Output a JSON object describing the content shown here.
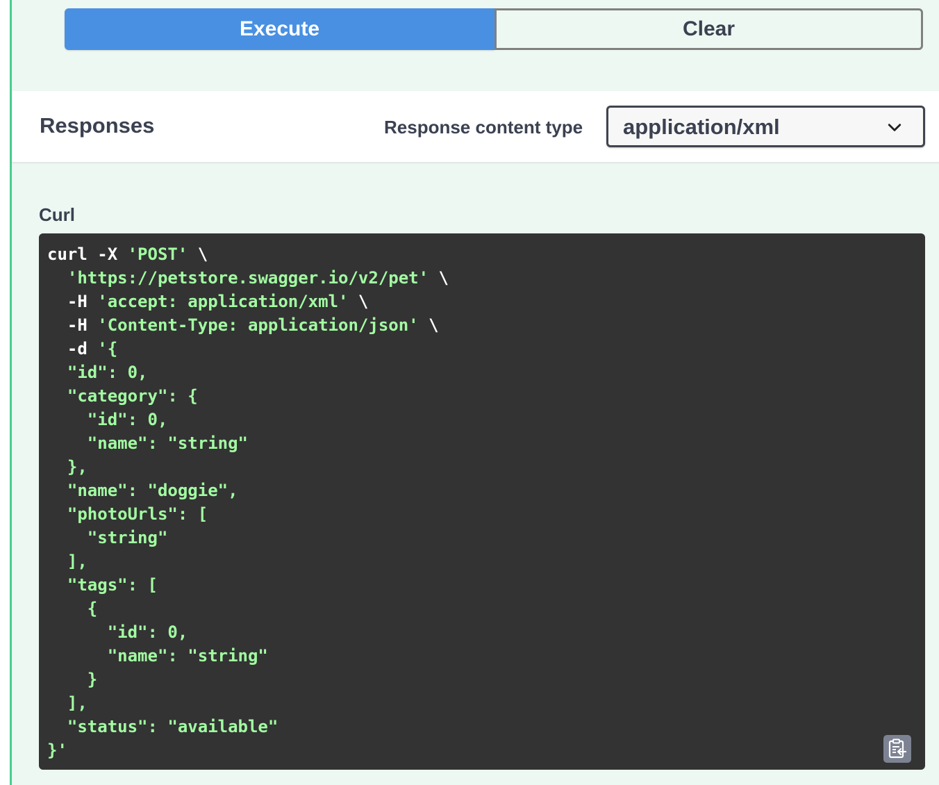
{
  "actions": {
    "execute_label": "Execute",
    "clear_label": "Clear"
  },
  "responses": {
    "title": "Responses",
    "content_type_label": "Response content type",
    "content_type_value": "application/xml"
  },
  "curl": {
    "label": "Curl",
    "lines": [
      [
        [
          "plain",
          "curl -X "
        ],
        [
          "str",
          "'POST'"
        ],
        [
          "plain",
          " \\"
        ]
      ],
      [
        [
          "plain",
          "  "
        ],
        [
          "str",
          "'https://petstore.swagger.io/v2/pet'"
        ],
        [
          "plain",
          " \\"
        ]
      ],
      [
        [
          "plain",
          "  -H "
        ],
        [
          "str",
          "'accept: application/xml'"
        ],
        [
          "plain",
          " \\"
        ]
      ],
      [
        [
          "plain",
          "  -H "
        ],
        [
          "str",
          "'Content-Type: application/json'"
        ],
        [
          "plain",
          " \\"
        ]
      ],
      [
        [
          "plain",
          "  -d "
        ],
        [
          "str",
          "'{"
        ]
      ],
      [
        [
          "str",
          "  \"id\": 0,"
        ]
      ],
      [
        [
          "str",
          "  \"category\": {"
        ]
      ],
      [
        [
          "str",
          "    \"id\": 0,"
        ]
      ],
      [
        [
          "str",
          "    \"name\": \"string\""
        ]
      ],
      [
        [
          "str",
          "  },"
        ]
      ],
      [
        [
          "str",
          "  \"name\": \"doggie\","
        ]
      ],
      [
        [
          "str",
          "  \"photoUrls\": ["
        ]
      ],
      [
        [
          "str",
          "    \"string\""
        ]
      ],
      [
        [
          "str",
          "  ],"
        ]
      ],
      [
        [
          "str",
          "  \"tags\": ["
        ]
      ],
      [
        [
          "str",
          "    {"
        ]
      ],
      [
        [
          "str",
          "      \"id\": 0,"
        ]
      ],
      [
        [
          "str",
          "      \"name\": \"string\""
        ]
      ],
      [
        [
          "str",
          "    }"
        ]
      ],
      [
        [
          "str",
          "  ],"
        ]
      ],
      [
        [
          "str",
          "  \"status\": \"available\""
        ]
      ],
      [
        [
          "str",
          "}'"
        ]
      ]
    ]
  },
  "icons": {
    "select_chevron": "chevron-down-icon",
    "copy": "clipboard-copy-icon"
  },
  "colors": {
    "execute_bg": "#4990e2",
    "panel_bg": "#edf8f2",
    "accent_border": "#49cc90",
    "code_bg": "#333333",
    "code_string": "#a2fca2"
  }
}
